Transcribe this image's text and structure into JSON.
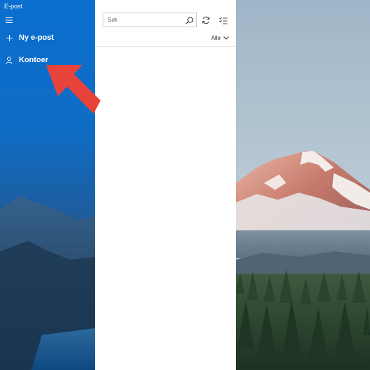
{
  "window": {
    "title": "E-post"
  },
  "sidebar": {
    "menu_icon": "hamburger-icon",
    "items": [
      {
        "label": "Ny e-post",
        "icon": "plus-icon"
      },
      {
        "label": "Kontoer",
        "icon": "person-icon"
      }
    ]
  },
  "list": {
    "search": {
      "placeholder": "Søk",
      "value": ""
    },
    "toolbar": {
      "sync_icon": "sync-icon",
      "selection_icon": "select-mode-icon"
    },
    "filter": {
      "label": "Alle"
    }
  },
  "colors": {
    "sidebar_blue": "#0a6fcf",
    "annotation_red": "#e8433a"
  }
}
